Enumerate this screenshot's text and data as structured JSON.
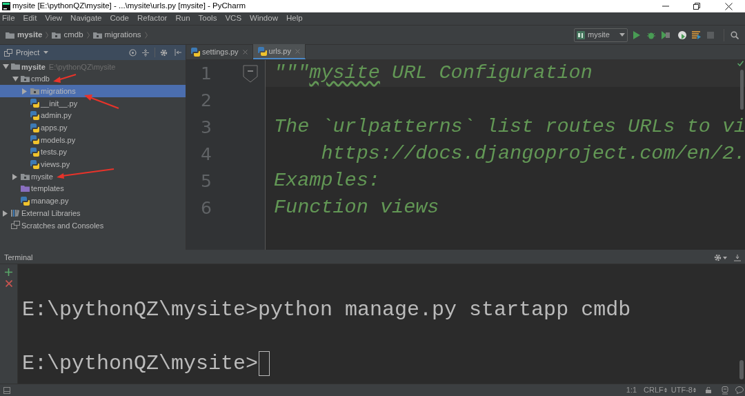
{
  "window": {
    "title": "mysite [E:\\pythonQZ\\mysite] - ...\\mysite\\urls.py [mysite] - PyCharm"
  },
  "menu": [
    "File",
    "Edit",
    "View",
    "Navigate",
    "Code",
    "Refactor",
    "Run",
    "Tools",
    "VCS",
    "Window",
    "Help"
  ],
  "breadcrumbs": [
    {
      "label": "mysite",
      "kind": "project"
    },
    {
      "label": "cmdb",
      "kind": "module"
    },
    {
      "label": "migrations",
      "kind": "module"
    }
  ],
  "run_config": {
    "label": "mysite"
  },
  "project_panel": {
    "title": "Project",
    "tree": [
      {
        "label": "mysite",
        "kind": "root",
        "hint": "E:\\pythonQZ\\mysite",
        "expanded": true,
        "selected": false,
        "children": [
          {
            "label": "cmdb",
            "kind": "folder",
            "expanded": true,
            "selected": false,
            "children": [
              {
                "label": "migrations",
                "kind": "folder",
                "expanded": false,
                "selected": true
              },
              {
                "label": "__init__.py",
                "kind": "python",
                "selected": false
              },
              {
                "label": "admin.py",
                "kind": "python",
                "selected": false
              },
              {
                "label": "apps.py",
                "kind": "python",
                "selected": false
              },
              {
                "label": "models.py",
                "kind": "python",
                "selected": false
              },
              {
                "label": "tests.py",
                "kind": "python",
                "selected": false
              },
              {
                "label": "views.py",
                "kind": "python",
                "selected": false
              }
            ]
          },
          {
            "label": "mysite",
            "kind": "folder",
            "expanded": false,
            "selected": false
          },
          {
            "label": "templates",
            "kind": "templates",
            "selected": false
          },
          {
            "label": "manage.py",
            "kind": "python",
            "selected": false
          }
        ]
      },
      {
        "label": "External Libraries",
        "kind": "libraries",
        "expanded": false,
        "selected": false
      },
      {
        "label": "Scratches and Consoles",
        "kind": "scratches",
        "selected": false
      }
    ]
  },
  "tabs": [
    {
      "label": "settings.py",
      "selected": false
    },
    {
      "label": "urls.py",
      "selected": true
    }
  ],
  "editor": {
    "lines": [
      {
        "number": "1",
        "segments": [
          {
            "text": "\"\"\"",
            "typo": false
          },
          {
            "text": "mysite",
            "typo": true
          },
          {
            "text": " URL Configuration",
            "typo": false
          }
        ]
      },
      {
        "number": "2"
      },
      {
        "number": "3",
        "segments": [
          {
            "text": "The `urlpatterns` list routes URLs to vi",
            "typo": false
          }
        ]
      },
      {
        "number": "4",
        "segments": [
          {
            "text": "    https://docs.djangoproject.com/en/2.",
            "typo": false
          }
        ]
      },
      {
        "number": "5",
        "segments": [
          {
            "text": "Examples:",
            "typo": false
          }
        ]
      },
      {
        "number": "6",
        "segments": [
          {
            "text": "Function views",
            "typo": false
          }
        ]
      }
    ]
  },
  "terminal": {
    "title": "Terminal",
    "lines": [
      "E:\\pythonQZ\\mysite>python manage.py startapp cmdb",
      "E:\\pythonQZ\\mysite>"
    ]
  },
  "status_bar": {
    "position": "1:1",
    "line_separator": "CRLF",
    "encoding": "UTF-8"
  }
}
